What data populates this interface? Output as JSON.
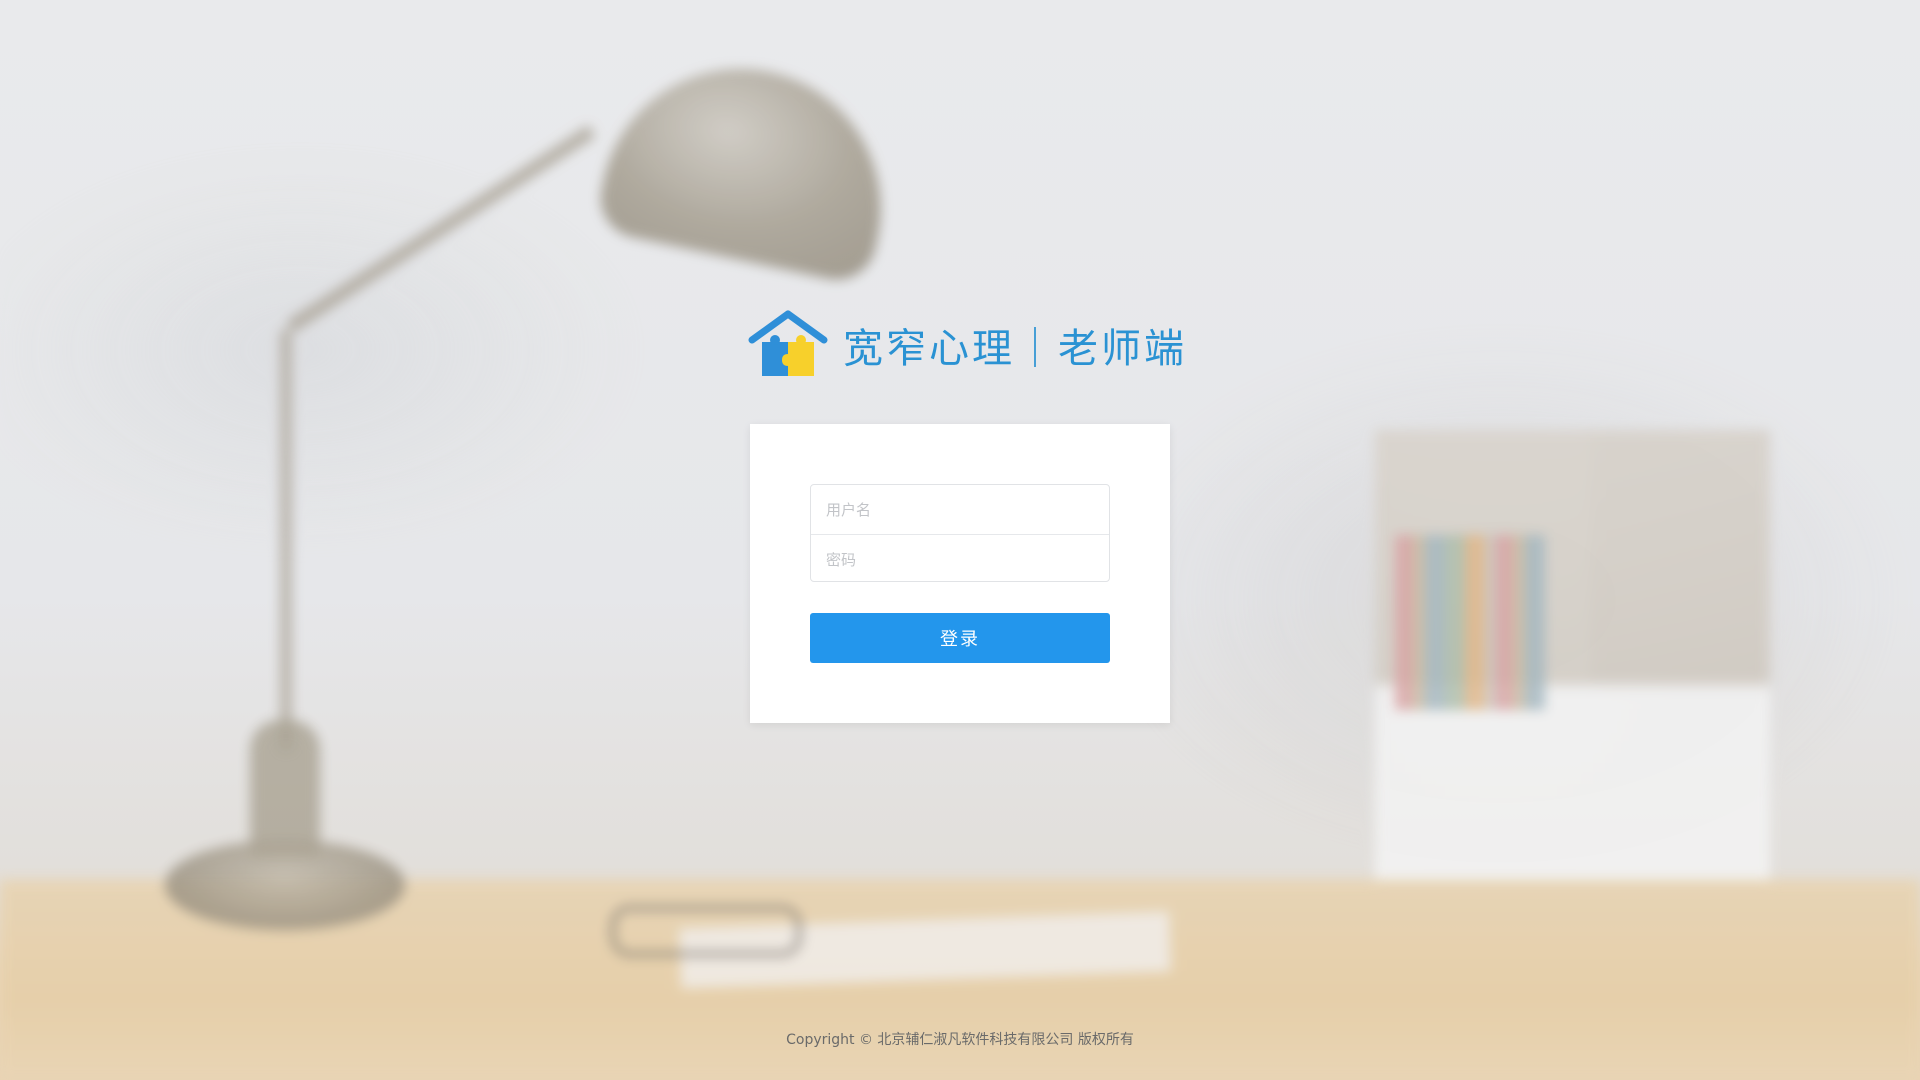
{
  "brand": {
    "logo_icon": "house-puzzle-icon",
    "title": "宽窄心理｜老师端",
    "colors": {
      "primary": "#2a92d3",
      "puzzle_blue": "#2f8fd8",
      "puzzle_yellow": "#f7d02b"
    }
  },
  "login": {
    "username_placeholder": "用户名",
    "password_placeholder": "密码",
    "submit_label": "登录",
    "button_color": "#2396ec"
  },
  "footer": {
    "copyright": "Copyright © 北京辅仁淑凡软件科技有限公司 版权所有"
  }
}
